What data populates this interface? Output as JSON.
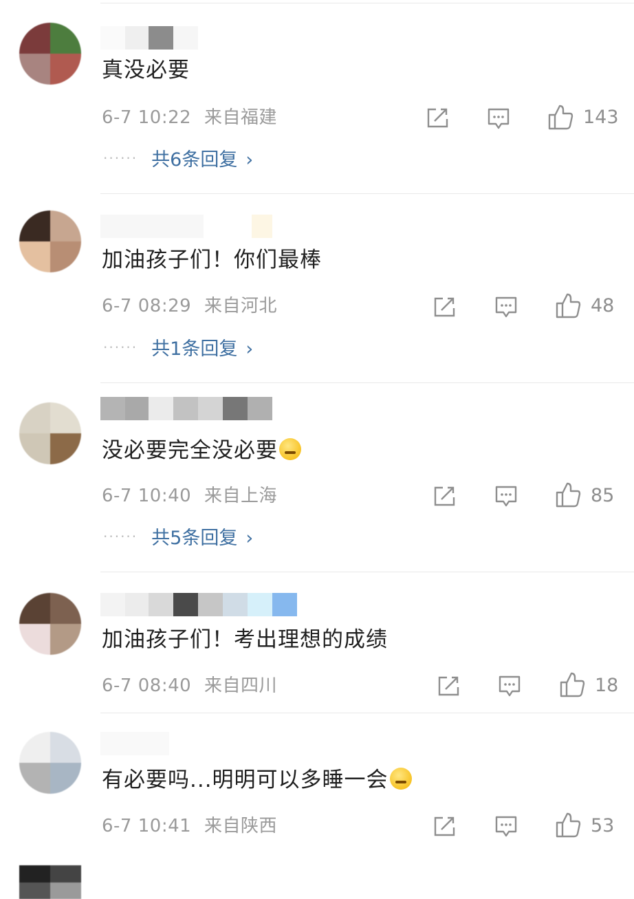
{
  "comments": [
    {
      "text": "真没必要",
      "time": "6-7 10:22",
      "location": "来自福建",
      "likes": "143",
      "replies_label": "共6条回复"
    },
    {
      "text": "加油孩子们！你们最棒",
      "time": "6-7 08:29",
      "location": "来自河北",
      "likes": "48",
      "replies_label": "共1条回复"
    },
    {
      "text": "没必要完全没必要",
      "time": "6-7 10:40",
      "location": "来自上海",
      "likes": "85",
      "replies_label": "共5条回复"
    },
    {
      "text": "加油孩子们！考出理想的成绩",
      "time": "6-7 08:40",
      "location": "来自四川",
      "likes": "18"
    },
    {
      "text": "有必要吗...明明可以多睡一会",
      "time": "6-7 10:41",
      "location": "来自陕西",
      "likes": "53"
    }
  ],
  "replies_more_glyph": "······",
  "replies_chevron": "›",
  "icons": {
    "share": "share-icon",
    "comment": "comment-icon",
    "like": "thumbs-up-icon",
    "emoji_sweat": "sweat-emoji-icon",
    "emoji_laugh": "laugh-cry-emoji-icon"
  }
}
